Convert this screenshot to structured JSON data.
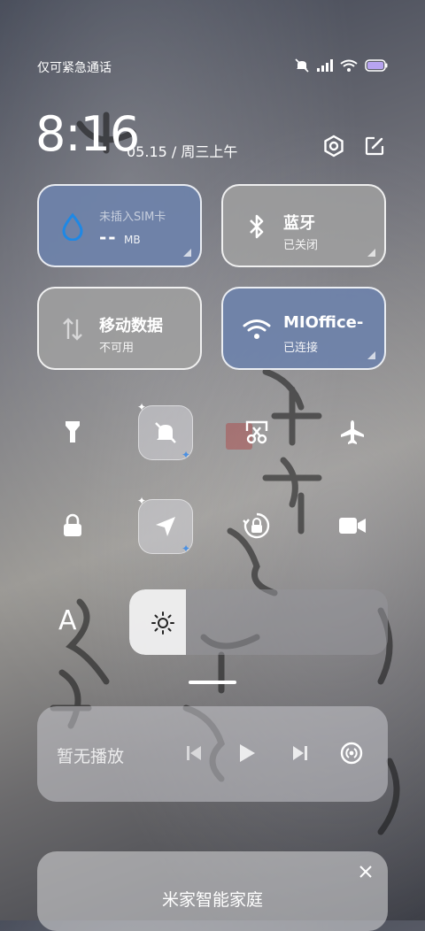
{
  "status_bar": {
    "carrier_text": "仅可紧急通话",
    "icons": [
      "silent-icon",
      "signal-icon",
      "wifi-icon",
      "battery-icon"
    ]
  },
  "header": {
    "time": "8:16",
    "date": "05.15 / 周三上午",
    "settings_icon": "gear-icon",
    "edit_icon": "edit-icon"
  },
  "tiles": {
    "sim": {
      "title": "未插入SIM卡",
      "value": "--",
      "unit": "MB",
      "icon": "water-drop-icon"
    },
    "bluetooth": {
      "title": "蓝牙",
      "subtitle": "已关闭",
      "icon": "bluetooth-icon"
    },
    "mobile_data": {
      "title": "移动数据",
      "subtitle": "不可用",
      "icon": "data-arrows-icon"
    },
    "wifi": {
      "title": "MIOffice-",
      "subtitle": "已连接",
      "icon": "wifi-icon"
    }
  },
  "quick_buttons": [
    {
      "name": "flashlight",
      "icon": "flashlight-icon",
      "active": false
    },
    {
      "name": "mute",
      "icon": "bell-off-icon",
      "active": true
    },
    {
      "name": "screenshot",
      "icon": "scissors-icon",
      "active": false
    },
    {
      "name": "airplane",
      "icon": "airplane-icon",
      "active": false
    },
    {
      "name": "lock",
      "icon": "lock-icon",
      "active": false
    },
    {
      "name": "location",
      "icon": "location-icon",
      "active": true
    },
    {
      "name": "rotation-lock",
      "icon": "rotation-lock-icon",
      "active": false
    },
    {
      "name": "screen-record",
      "icon": "video-camera-icon",
      "active": false
    }
  ],
  "brightness": {
    "level": 0.22,
    "auto_label": "A",
    "icon": "sun-icon"
  },
  "media": {
    "status": "暂无播放",
    "controls": [
      "previous-icon",
      "play-icon",
      "next-icon",
      "cast-icon"
    ]
  },
  "notification": {
    "title": "米家智能家庭",
    "close_icon": "close-icon"
  },
  "colors": {
    "tile_active": "#6e82aa",
    "tile_inactive": "#a0a0a0",
    "bluetooth_icon_accent": "#4a90e2"
  }
}
